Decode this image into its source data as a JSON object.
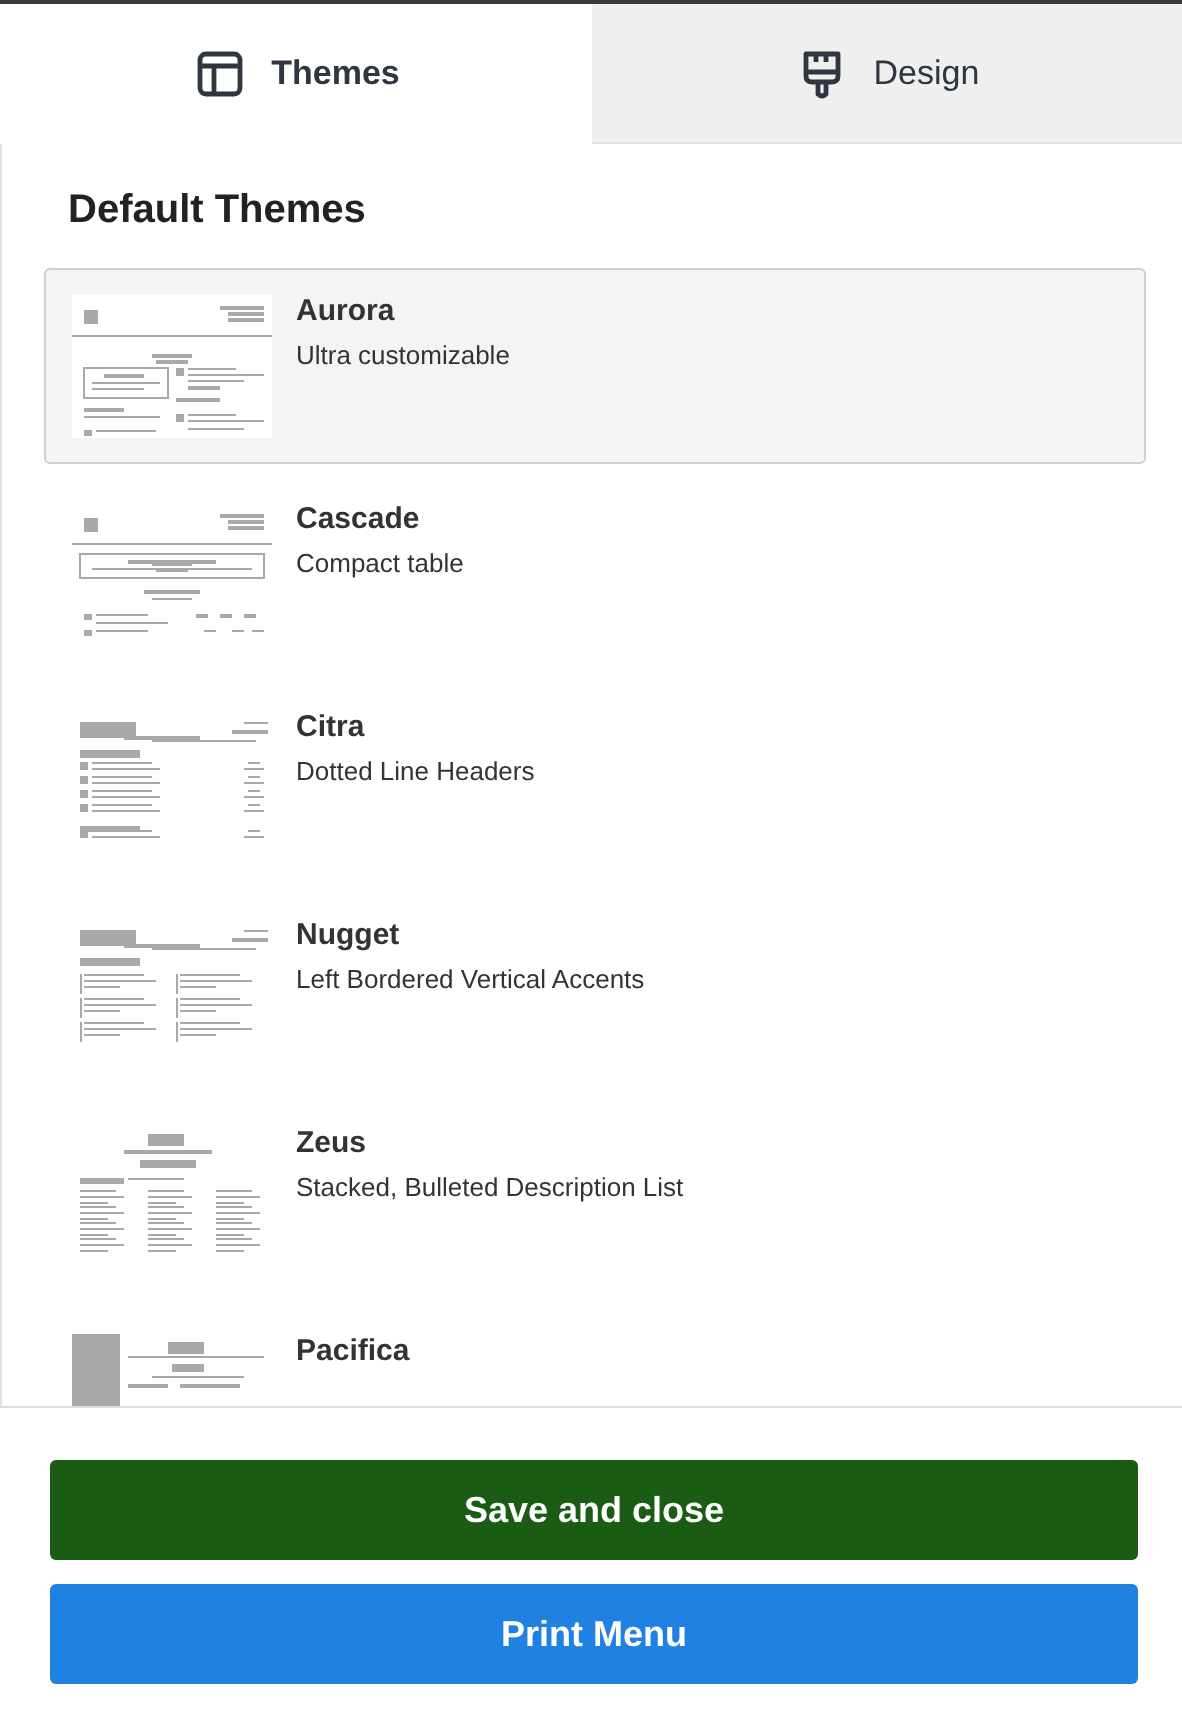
{
  "tabs": [
    {
      "label": "Themes",
      "selected": true
    },
    {
      "label": "Design",
      "selected": false
    }
  ],
  "section_title": "Default Themes",
  "themes": [
    {
      "name": "Aurora",
      "description": "Ultra customizable",
      "selected": true
    },
    {
      "name": "Cascade",
      "description": "Compact table",
      "selected": false
    },
    {
      "name": "Citra",
      "description": "Dotted Line Headers",
      "selected": false
    },
    {
      "name": "Nugget",
      "description": "Left Bordered Vertical Accents",
      "selected": false
    },
    {
      "name": "Zeus",
      "description": "Stacked, Bulleted Description List",
      "selected": false
    },
    {
      "name": "Pacifica",
      "selected": false
    }
  ],
  "buttons": [
    {
      "label": "Save and close",
      "kind": "primary"
    },
    {
      "label": "Print Menu",
      "kind": "secondary"
    }
  ]
}
